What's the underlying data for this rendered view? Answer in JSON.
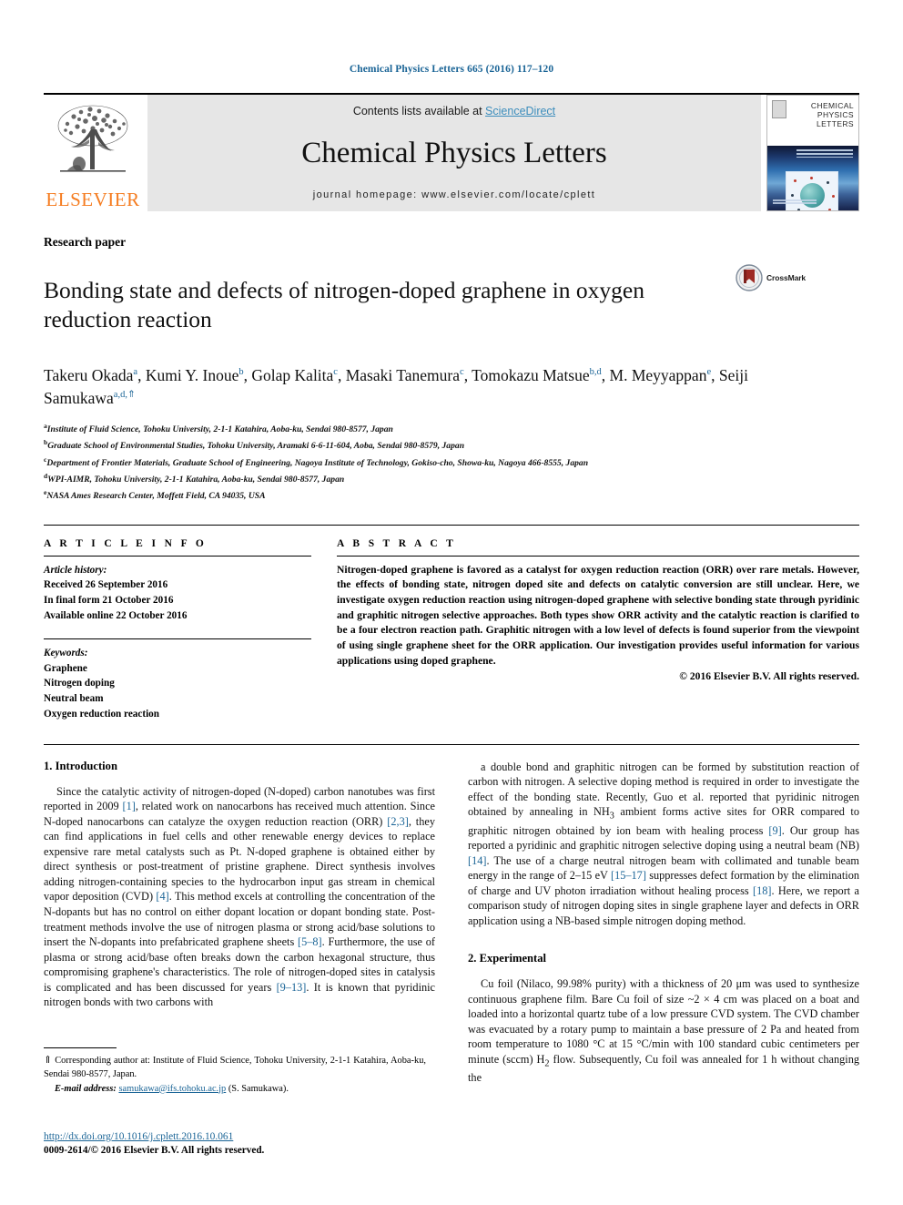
{
  "running_head": "Chemical Physics Letters 665 (2016) 117–120",
  "masthead": {
    "publisher_logo_word": "ELSEVIER",
    "contents_prefix": "Contents lists available at ",
    "contents_link": "ScienceDirect",
    "journal_title": "Chemical Physics Letters",
    "homepage_line": "journal homepage: www.elsevier.com/locate/cplett",
    "cover": {
      "line1": "CHEMICAL",
      "line2": "PHYSICS",
      "line3": "LETTERS"
    }
  },
  "article": {
    "kicker": "Research paper",
    "title": "Bonding state and defects of nitrogen-doped graphene in oxygen reduction reaction",
    "crossmark_label": "CrossMark",
    "authors": [
      {
        "name": "Takeru Okada",
        "sup": "a",
        "sep": ", "
      },
      {
        "name": "Kumi Y. Inoue",
        "sup": "b",
        "sep": ", "
      },
      {
        "name": "Golap Kalita",
        "sup": "c",
        "sep": ", "
      },
      {
        "name": "Masaki Tanemura",
        "sup": "c",
        "sep": ", "
      },
      {
        "name": "Tomokazu Matsue",
        "sup": "b,d",
        "sep": ", "
      },
      {
        "name": "M. Meyyappan",
        "sup": "e",
        "sep": ", "
      },
      {
        "name": "Seiji Samukawa",
        "sup": "a,d,",
        "sup_star": "⇑",
        "sep": ""
      }
    ],
    "affiliations": [
      {
        "mark": "a",
        "text": "Institute of Fluid Science, Tohoku University, 2-1-1 Katahira, Aoba-ku, Sendai 980-8577, Japan"
      },
      {
        "mark": "b",
        "text": "Graduate School of Environmental Studies, Tohoku University, Aramaki 6-6-11-604, Aoba, Sendai 980-8579, Japan"
      },
      {
        "mark": "c",
        "text": "Department of Frontier Materials, Graduate School of Engineering, Nagoya Institute of Technology, Gokiso-cho, Showa-ku, Nagoya 466-8555, Japan"
      },
      {
        "mark": "d",
        "text": "WPI-AIMR, Tohoku University, 2-1-1 Katahira, Aoba-ku, Sendai 980-8577, Japan"
      },
      {
        "mark": "e",
        "text": "NASA Ames Research Center, Moffett Field, CA 94035, USA"
      }
    ]
  },
  "article_info": {
    "heading": "A R T I C L E   I N F O",
    "history_label": "Article history:",
    "history": [
      "Received 26 September 2016",
      "In final form 21 October 2016",
      "Available online 22 October 2016"
    ],
    "keywords_label": "Keywords:",
    "keywords": [
      "Graphene",
      "Nitrogen doping",
      "Neutral beam",
      "Oxygen reduction reaction"
    ]
  },
  "abstract": {
    "heading": "A B S T R A C T",
    "text": "Nitrogen-doped graphene is favored as a catalyst for oxygen reduction reaction (ORR) over rare metals. However, the effects of bonding state, nitrogen doped site and defects on catalytic conversion are still unclear. Here, we investigate oxygen reduction reaction using nitrogen-doped graphene with selective bonding state through pyridinic and graphitic nitrogen selective approaches. Both types show ORR activity and the catalytic reaction is clarified to be a four electron reaction path. Graphitic nitrogen with a low level of defects is found superior from the viewpoint of using single graphene sheet for the ORR application. Our investigation provides useful information for various applications using doped graphene.",
    "copyright": "© 2016 Elsevier B.V. All rights reserved."
  },
  "body": {
    "left": {
      "section_heading": "1. Introduction",
      "paragraph_html": "Since the catalytic activity of nitrogen-doped (N-doped) carbon nanotubes was first reported in 2009 <span class=\"ref\">[1]</span>, related work on nanocarbons has received much attention. Since N-doped nanocarbons can catalyze the oxygen reduction reaction (ORR) <span class=\"ref\">[2,3]</span>, they can find applications in fuel cells and other renewable energy devices to replace expensive rare metal catalysts such as Pt. N-doped graphene is obtained either by direct synthesis or post-treatment of pristine graphene. Direct synthesis involves adding nitrogen-containing species to the hydrocarbon input gas stream in chemical vapor deposition (CVD) <span class=\"ref\">[4]</span>. This method excels at controlling the concentration of the N-dopants but has no control on either dopant location or dopant bonding state. Post-treatment methods involve the use of nitrogen plasma or strong acid/base solutions to insert the N-dopants into prefabricated graphene sheets <span class=\"ref\">[5–8]</span>. Furthermore, the use of plasma or strong acid/base often breaks down the carbon hexagonal structure, thus compromising graphene's characteristics. The role of nitrogen-doped sites in catalysis is complicated and has been discussed for years <span class=\"ref\">[9–13]</span>. It is known that pyridinic nitrogen bonds with two carbons with"
    },
    "right": {
      "paragraph1_html": "a double bond and graphitic nitrogen can be formed by substitution reaction of carbon with nitrogen. A selective doping method is required in order to investigate the effect of the bonding state. Recently, Guo et al. reported that pyridinic nitrogen obtained by annealing in NH<sub>3</sub> ambient forms active sites for ORR compared to graphitic nitrogen obtained by ion beam with healing process <span class=\"ref\">[9]</span>. Our group has reported a pyridinic and graphitic nitrogen selective doping using a neutral beam (NB) <span class=\"ref\">[14]</span>. The use of a charge neutral nitrogen beam with collimated and tunable beam energy in the range of 2–15 eV <span class=\"ref\">[15–17]</span> suppresses defect formation by the elimination of charge and UV photon irradiation without healing process <span class=\"ref\">[18]</span>. Here, we report a comparison study of nitrogen doping sites in single graphene layer and defects in ORR application using a NB-based simple nitrogen doping method.",
      "section_heading": "2. Experimental",
      "paragraph2_html": "Cu foil (Nilaco, 99.98% purity) with a thickness of 20 μm was used to synthesize continuous graphene film. Bare Cu foil of size ~2 × 4 cm was placed on a boat and loaded into a horizontal quartz tube of a low pressure CVD system. The CVD chamber was evacuated by a rotary pump to maintain a base pressure of 2 Pa and heated from room temperature to 1080 °C at 15 °C/min with 100 standard cubic centimeters per minute (sccm) H<sub>2</sub> flow. Subsequently, Cu foil was annealed for 1 h without changing the"
    }
  },
  "footnote": {
    "star": "⇑",
    "text": " Corresponding author at: Institute of Fluid Science, Tohoku University, 2-1-1 Katahira, Aoba-ku, Sendai 980-8577, Japan.",
    "email_label": "E-mail address:",
    "email": "samukawa@ifs.tohoku.ac.jp",
    "email_suffix": " (S. Samukawa)."
  },
  "footer": {
    "doi": "http://dx.doi.org/10.1016/j.cplett.2016.10.061",
    "issn_line": "0009-2614/© 2016 Elsevier B.V. All rights reserved."
  },
  "colors": {
    "link_blue": "#1a6496",
    "sciencedirect_blue": "#3c8dbc",
    "elsevier_orange": "#f57c20",
    "masthead_grey": "#e6e6e6",
    "crossmark_red": "#9e2a24"
  }
}
